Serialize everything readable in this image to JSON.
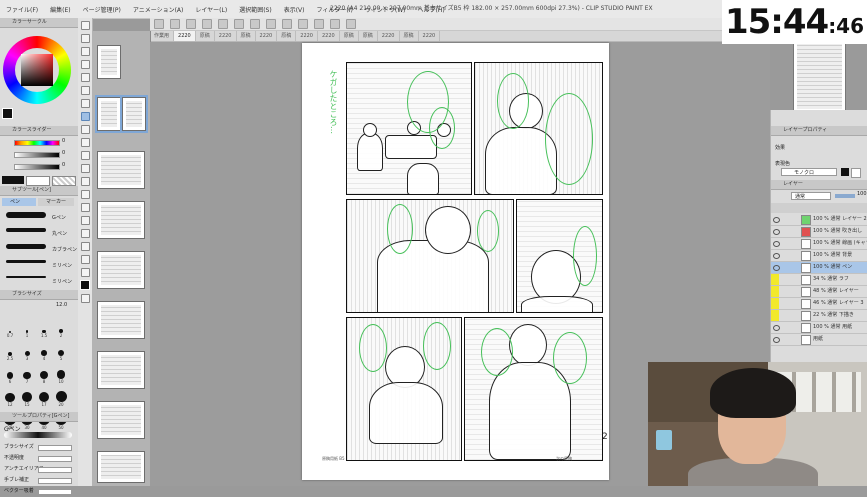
{
  "menubar": {
    "items": [
      "ファイル(F)",
      "編集(E)",
      "ページ管理(P)",
      "アニメーション(A)",
      "レイヤー(L)",
      "選択範囲(S)",
      "表示(V)",
      "フィルター(I)",
      "ウィンドウ(W)",
      "ヘルプ(H)"
    ],
    "title": "2220 (A4 210.00 × 297.00mm 基本サイズB5 枠 182.00 × 257.00mm 600dpi 27.3%) - CLIP STUDIO PAINT EX"
  },
  "clock": {
    "hhmm": "15:44",
    "sec": ":46"
  },
  "tabs": [
    "作業用",
    "2220",
    "原稿",
    "2220",
    "原稿",
    "2220",
    "原稿",
    "2220",
    "2220",
    "原稿",
    "原稿",
    "2220",
    "原稿",
    "2220"
  ],
  "left_panel": {
    "color_header": "カラーサークル",
    "slider_header": "カラースライダー",
    "slider_values": [
      "0",
      "0",
      "0"
    ],
    "subtool_header": "サブツール[ペン]",
    "subtool_tabs": [
      "ペン",
      "マーカー"
    ],
    "brush_labels": [
      "Gペン",
      "丸ペン",
      "カブラペン",
      "ミリペン",
      "ミリペン"
    ],
    "brush_size_header": "ブラシサイズ",
    "brush_size_value": "12.0",
    "brush_dot_labels": [
      "0.7",
      "1",
      "1.5",
      "2",
      "2.5",
      "3",
      "4",
      "5",
      "6",
      "7",
      "8",
      "10",
      "12",
      "15",
      "17",
      "20",
      "25",
      "30",
      "40",
      "50"
    ],
    "tool_prop_header": "ツールプロパティ[Gペン]",
    "tool_prop_name": "Gペン",
    "props": [
      "ブラシサイズ",
      "不透明度",
      "アンチエイリアス",
      "手ブレ補正",
      "ベクター吸着"
    ]
  },
  "canvas": {
    "page_number": "2",
    "vertical_text": "ケガしたところ…",
    "footer_left": "原稿用紙 B5",
    "footer_right": "次の原稿"
  },
  "right_panel": {
    "layer_prop_header": "レイヤープロパティ",
    "effect_label": "効果",
    "expression_label": "表現色",
    "expression_value": "モノクロ",
    "layer_header": "レイヤー",
    "blend_mode": "通常",
    "opacity": "100",
    "layers": [
      {
        "name": "100 % 通常 レイヤー 2",
        "selected": false
      },
      {
        "name": "100 % 通常 吹き出し",
        "selected": false
      },
      {
        "name": "100 % 通常 線画 (キャラ)",
        "selected": false
      },
      {
        "name": "100 % 通常 背景",
        "selected": false
      },
      {
        "name": "100 % 通常 ペン",
        "selected": true
      },
      {
        "name": "34 % 通常 ラフ",
        "selected": false
      },
      {
        "name": "48 % 通常 レイヤー",
        "selected": false
      },
      {
        "name": "46 % 通常 レイヤー 3",
        "selected": false
      },
      {
        "name": "22 % 通常 下描き",
        "selected": false
      },
      {
        "name": "100 % 通常 用紙",
        "selected": false
      },
      {
        "name": "用紙",
        "selected": false
      }
    ]
  }
}
